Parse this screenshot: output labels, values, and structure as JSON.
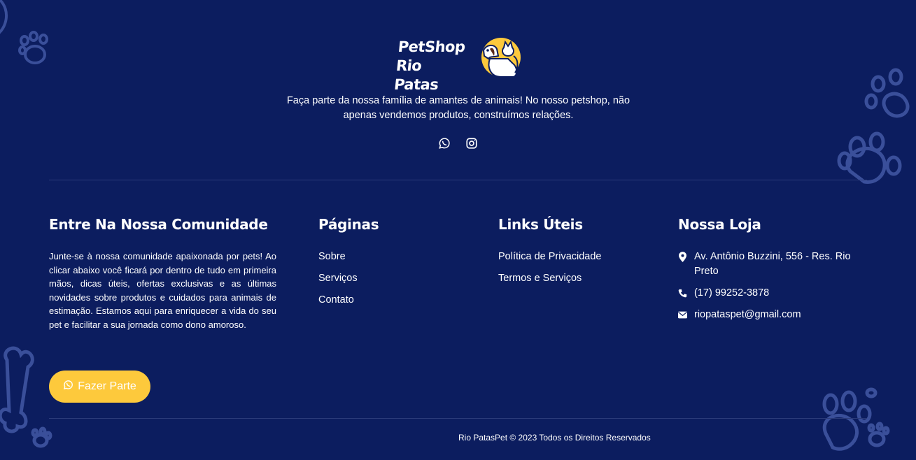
{
  "brand": {
    "logo_line1": "PetShop",
    "logo_line2": "Rio Patas",
    "accent_color": "#fdc93c",
    "background_color": "#0c1d5f"
  },
  "hero": {
    "tagline": "Faça parte da nossa família de amantes de animais! No nosso petshop, não apenas vendemos produtos, construímos relações.",
    "social_icons": [
      "whatsapp-icon",
      "instagram-icon"
    ]
  },
  "community": {
    "heading": "Entre Na Nossa Comunidade",
    "text": "Junte-se à nossa comunidade apaixonada por pets! Ao clicar abaixo você ficará por dentro de tudo em primeira mãos, dicas úteis, ofertas exclusivas e as últimas novidades sobre produtos e cuidados para animais de estimação. Estamos aqui para enriquecer a vida do seu pet e facilitar a sua jornada como dono amoroso.",
    "button_label": "Fazer Parte",
    "button_icon": "whatsapp-icon"
  },
  "pages": {
    "heading": "Páginas",
    "items": [
      "Sobre",
      "Serviços",
      "Contato"
    ]
  },
  "useful_links": {
    "heading": "Links Úteis",
    "items": [
      "Política de Privacidade",
      "Termos e Serviços"
    ]
  },
  "store": {
    "heading": "Nossa Loja",
    "address": "Av. Antônio Buzzini, 556 - Res. Rio Preto",
    "phone": "(17) 99252-3878",
    "email": "riopataspet@gmail.com",
    "icons": [
      "map-pin-icon",
      "phone-icon",
      "envelope-icon"
    ]
  },
  "footer": {
    "copyright": "Rio PatasPet © 2023 Todos os Direitos Reservados"
  }
}
